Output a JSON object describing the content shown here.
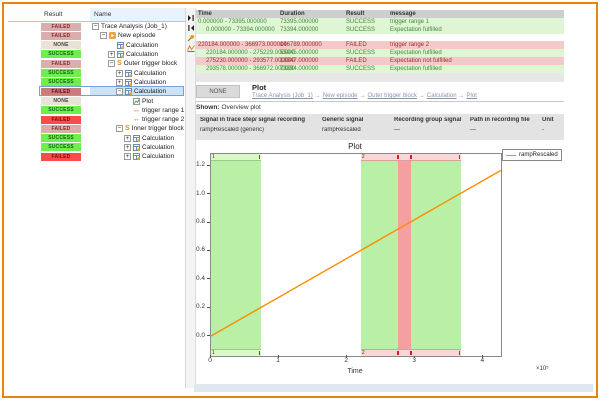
{
  "tree": {
    "columns": [
      "Result",
      "Name"
    ],
    "rows": [
      {
        "result": "FAILED",
        "status": "failed",
        "label": "Trace Analysis (Job_1)",
        "indent": 0,
        "expander": "minus",
        "icon": "none",
        "selected": false
      },
      {
        "result": "FAILED",
        "status": "failed",
        "label": "New episode",
        "indent": 1,
        "expander": "minus",
        "icon": "episode",
        "selected": false
      },
      {
        "result": "NONE",
        "status": "none",
        "label": "Calculation",
        "indent": 2,
        "expander": "none",
        "icon": "calculation",
        "selected": false
      },
      {
        "result": "SUCCESS",
        "status": "success",
        "label": "Calculation",
        "indent": 2,
        "expander": "plus",
        "icon": "calculation",
        "selected": false
      },
      {
        "result": "FAILED",
        "status": "failed",
        "label": "Outer trigger block",
        "indent": 2,
        "expander": "minus",
        "icon": "trigger-block",
        "selected": false
      },
      {
        "result": "SUCCESS",
        "status": "success",
        "label": "Calculation",
        "indent": 3,
        "expander": "plus",
        "icon": "calculation",
        "selected": false
      },
      {
        "result": "SUCCESS",
        "status": "success",
        "label": "Calculation",
        "indent": 3,
        "expander": "plus",
        "icon": "calculation",
        "selected": false
      },
      {
        "result": "FAILED",
        "status": "failed-mid",
        "label": "Calculation",
        "indent": 3,
        "expander": "minus",
        "icon": "calculation",
        "selected": true
      },
      {
        "result": "NONE",
        "status": "none",
        "label": "Plot",
        "indent": 4,
        "expander": "none",
        "icon": "plot",
        "selected": false
      },
      {
        "result": "SUCCESS",
        "status": "success",
        "label": "trigger range 1",
        "indent": 4,
        "expander": "none",
        "icon": "trigger-range",
        "selected": false
      },
      {
        "result": "FAILED",
        "status": "failed-bright",
        "label": "trigger range 2",
        "indent": 4,
        "expander": "none",
        "icon": "trigger-range",
        "selected": false
      },
      {
        "result": "FAILED",
        "status": "failed",
        "label": "Inner trigger block",
        "indent": 3,
        "expander": "minus",
        "icon": "trigger-block",
        "selected": false
      },
      {
        "result": "SUCCESS",
        "status": "success",
        "label": "Calculation",
        "indent": 4,
        "expander": "plus",
        "icon": "calculation",
        "selected": false
      },
      {
        "result": "SUCCESS",
        "status": "success",
        "label": "Calculation",
        "indent": 4,
        "expander": "plus",
        "icon": "calculation",
        "selected": false
      },
      {
        "result": "FAILED",
        "status": "failed-bright",
        "label": "Calculation",
        "indent": 4,
        "expander": "plus",
        "icon": "calculation",
        "selected": false
      }
    ]
  },
  "result_table": {
    "headers": [
      "Time",
      "Duration",
      "Result",
      "message"
    ],
    "rows": [
      {
        "time": "0.000000 - 73395.000000",
        "duration": "73395.000000",
        "result": "SUCCESS",
        "message": "trigger range 1",
        "tone": "green",
        "indent": false,
        "gap_before": false
      },
      {
        "time": "0.000000 - 73394.000000",
        "duration": "73394.000000",
        "result": "SUCCESS",
        "message": "Expectation fulfilled",
        "tone": "green",
        "indent": true,
        "gap_before": false
      },
      {
        "time": "220184.000000 - 366973.000000",
        "duration": "146789.000000",
        "result": "FAILED",
        "message": "trigger range 2",
        "tone": "red",
        "indent": false,
        "gap_before": true
      },
      {
        "time": "220184.000000 - 275229.000000",
        "duration": "55045.000000",
        "result": "SUCCESS",
        "message": "Expectation fulfilled",
        "tone": "green",
        "indent": true,
        "gap_before": false
      },
      {
        "time": "275230.000000 - 293577.000000",
        "duration": "18347.000000",
        "result": "FAILED",
        "message": "Expectation not fulfilled",
        "tone": "red",
        "indent": true,
        "gap_before": false
      },
      {
        "time": "293578.000000 - 366972.000000",
        "duration": "73394.000000",
        "result": "SUCCESS",
        "message": "Expectation fulfilled",
        "tone": "green",
        "indent": true,
        "gap_before": false
      }
    ]
  },
  "detail": {
    "tab_none": "NONE",
    "title": "Plot",
    "breadcrumb": [
      "Trace Analysis (Job_1)",
      "New episode",
      "Outer trigger block",
      "Calculation",
      "Plot"
    ],
    "breadcrumb_separator": "→",
    "shown_label": "Shown:",
    "shown_value": "Overview plot",
    "signal_table": {
      "headers": [
        "Signal in trace step/ signal recording",
        "Generic signal",
        "Recording group signal",
        "Path in recording file",
        "Unit"
      ],
      "values": [
        "rampRescaled (generic)",
        "rampRescaled",
        "—",
        "—",
        "-"
      ]
    }
  },
  "plot": {
    "title": "Plot",
    "legend_label": "rampRescaled",
    "line_color": "#ff8c00",
    "xlabel": "Time",
    "x_offset_label": "×10⁵",
    "x_ticks": [
      "0",
      "1",
      "2",
      "3",
      "4"
    ],
    "x_tick_values": [
      0,
      100000,
      200000,
      300000,
      400000
    ],
    "y_ticks": [
      "1.2",
      "1.0",
      "0.8",
      "0.6",
      "0.4",
      "0.2",
      "0.0"
    ],
    "y_tick_values": [
      1.2,
      1.0,
      0.8,
      0.6,
      0.4,
      0.2,
      0.0
    ],
    "x_range": [
      0,
      426000
    ],
    "y_range": [
      -0.141,
      1.284
    ],
    "series": [
      {
        "name": "rampRescaled",
        "points": [
          [
            0,
            0.0
          ],
          [
            426000,
            1.169
          ]
        ]
      }
    ],
    "bands": [
      {
        "x0": 0,
        "x1": 73395,
        "tone": "green"
      },
      {
        "x0": 220184,
        "x1": 275229,
        "tone": "green"
      },
      {
        "x0": 275230,
        "x1": 293577,
        "tone": "red"
      },
      {
        "x0": 293578,
        "x1": 366972,
        "tone": "green"
      }
    ],
    "range_strips": [
      {
        "x0": 0,
        "x1": 73395,
        "tone": "green",
        "label": "1",
        "markers": []
      },
      {
        "x0": 220184,
        "x1": 366973,
        "tone": "red",
        "label": "2",
        "markers": [
          275230,
          293577
        ]
      }
    ]
  },
  "colors": {
    "frame": "#e8830d",
    "success": "#71ee4f",
    "failed": "#fb4b4b",
    "band_green": "#b9f0a5",
    "band_red": "#f4a0a0"
  }
}
